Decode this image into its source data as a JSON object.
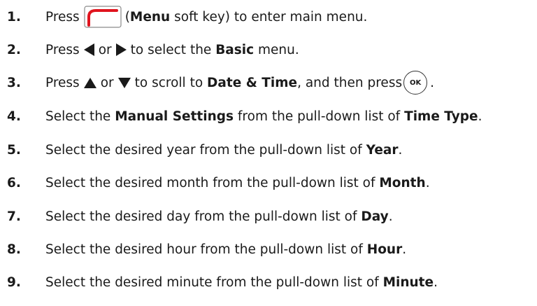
{
  "steps": [
    {
      "number": "1.",
      "parts": {
        "a": "Press",
        "b": "(",
        "c": "Menu",
        "d": " soft key) to enter main menu."
      }
    },
    {
      "number": "2.",
      "parts": {
        "a": "Press",
        "b": "or",
        "c": "to select the ",
        "d": "Basic",
        "e": " menu."
      }
    },
    {
      "number": "3.",
      "parts": {
        "a": "Press",
        "b": "or",
        "c": "to scroll to ",
        "d": "Date & Time",
        "e": ", and then press",
        "f": "."
      },
      "ok_label": "OK"
    },
    {
      "number": "4.",
      "parts": {
        "a": "Select the ",
        "b": "Manual Settings",
        "c": " from the pull-down list of ",
        "d": "Time Type",
        "e": "."
      }
    },
    {
      "number": "5.",
      "parts": {
        "a": "Select the desired year from the pull-down list of ",
        "b": "Year",
        "c": "."
      }
    },
    {
      "number": "6.",
      "parts": {
        "a": "Select the desired month from the pull-down list of ",
        "b": "Month",
        "c": "."
      }
    },
    {
      "number": "7.",
      "parts": {
        "a": "Select the desired day from the pull-down list of ",
        "b": "Day",
        "c": "."
      }
    },
    {
      "number": "8.",
      "parts": {
        "a": "Select the desired hour from the pull-down list of ",
        "b": "Hour",
        "c": "."
      }
    },
    {
      "number": "9.",
      "parts": {
        "a": "Select the desired minute from the pull-down list of ",
        "b": "Minute",
        "c": "."
      }
    }
  ],
  "colors": {
    "softkey_accent": "#e0141e",
    "softkey_border": "#8a8a8a",
    "text": "#1a1a1a"
  }
}
